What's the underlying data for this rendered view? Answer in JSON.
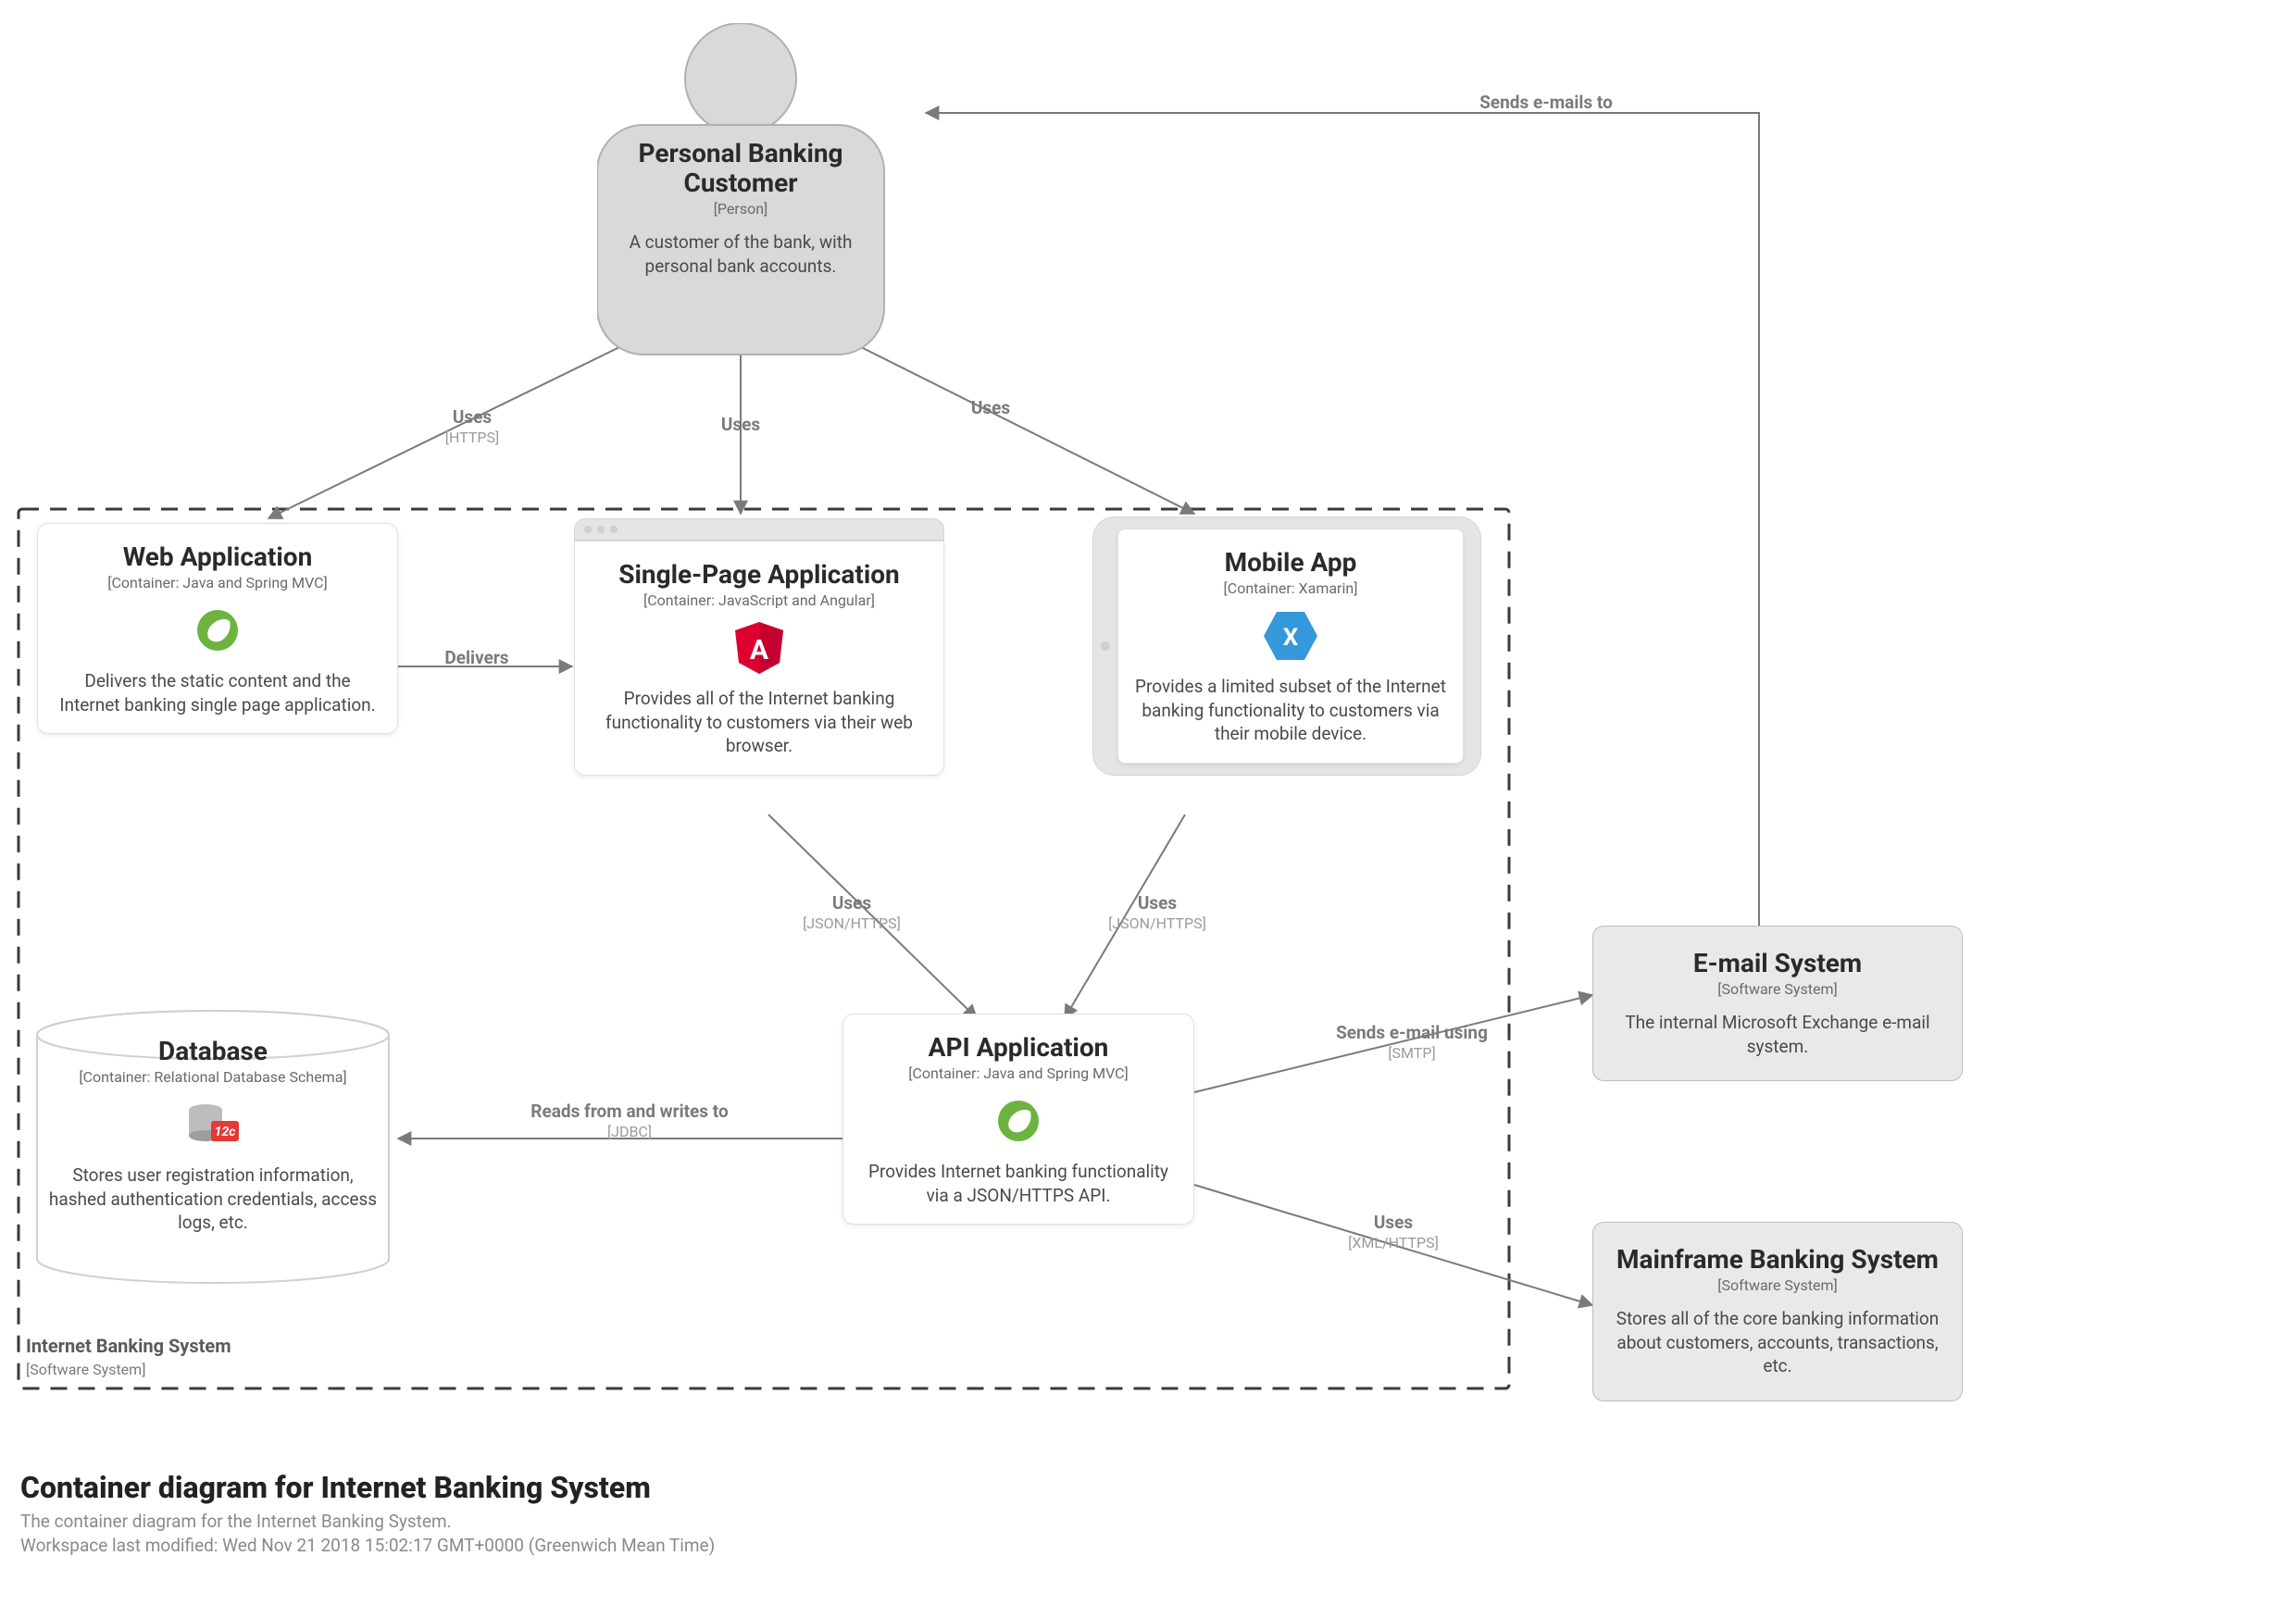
{
  "person": {
    "title": "Personal Banking Customer",
    "subtitle": "[Person]",
    "desc": "A customer of the bank, with personal bank accounts."
  },
  "containers": {
    "web": {
      "title": "Web Application",
      "subtitle": "[Container: Java and Spring MVC]",
      "desc": "Delivers the static content and the Internet banking single page application."
    },
    "spa": {
      "title": "Single-Page Application",
      "subtitle": "[Container: JavaScript and Angular]",
      "desc": "Provides all of the Internet banking functionality to customers via their web browser."
    },
    "mobile": {
      "title": "Mobile App",
      "subtitle": "[Container: Xamarin]",
      "desc": "Provides a limited subset of the Internet banking functionality to customers via their mobile device."
    },
    "api": {
      "title": "API Application",
      "subtitle": "[Container: Java and Spring MVC]",
      "desc": "Provides Internet banking functionality via a JSON/HTTPS API."
    },
    "db": {
      "title": "Database",
      "subtitle": "[Container: Relational Database Schema]",
      "desc": "Stores user registration information, hashed authentication credentials, access logs, etc."
    }
  },
  "externals": {
    "email": {
      "title": "E-mail System",
      "subtitle": "[Software System]",
      "desc": "The internal Microsoft Exchange e-mail system."
    },
    "mainframe": {
      "title": "Mainframe Banking System",
      "subtitle": "[Software System]",
      "desc": "Stores all of the core banking information about customers, accounts, transactions, etc."
    }
  },
  "edges": {
    "uses_web": {
      "label": "Uses",
      "sub": "[HTTPS]"
    },
    "uses_spa": {
      "label": "Uses"
    },
    "uses_mobile": {
      "label": "Uses"
    },
    "delivers": {
      "label": "Delivers"
    },
    "uses_api_spa": {
      "label": "Uses",
      "sub": "[JSON/HTTPS]"
    },
    "uses_api_mobile": {
      "label": "Uses",
      "sub": "[JSON/HTTPS]"
    },
    "reads_writes": {
      "label": "Reads from and writes to",
      "sub": "[JDBC]"
    },
    "sends_email_using": {
      "label": "Sends e-mail using",
      "sub": "[SMTP]"
    },
    "uses_mainframe": {
      "label": "Uses",
      "sub": "[XML/HTTPS]"
    },
    "sends_emails_to": {
      "label": "Sends e-mails to"
    }
  },
  "boundary": {
    "label": "Internet Banking System",
    "sub": "[Software System]"
  },
  "footer": {
    "title": "Container diagram for Internet Banking System",
    "line1": "The container diagram for the Internet Banking System.",
    "line2": "Workspace last modified: Wed Nov 21 2018 15:02:17 GMT+0000 (Greenwich Mean Time)"
  }
}
